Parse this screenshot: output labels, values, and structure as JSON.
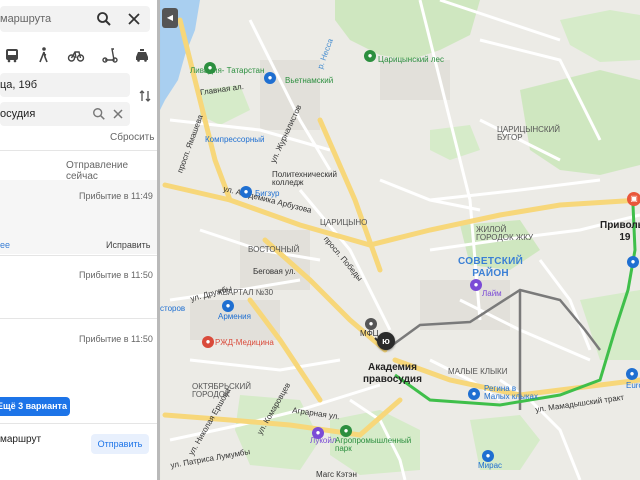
{
  "panel": {
    "search_label": "маршрута",
    "from_value": "ца, 19б",
    "to_value": "осудия",
    "reset_label": "Сбросить",
    "departure_label": "Отправление сейчас",
    "routes": [
      {
        "arrival": "Прибытие в 11:49",
        "more": "ee",
        "fix": "Исправить"
      },
      {
        "arrival": "Прибытие в 11:50"
      },
      {
        "arrival": "Прибытие в 11:50"
      }
    ],
    "more_variants_label": "Ещё 3 варианта",
    "share_label": "маршрут",
    "send_label": "Отправить"
  },
  "map": {
    "labels": {
      "lividia": "Ливадия-\nТатарстан",
      "vietnamsky": "Вьетнамский",
      "tsaritsynsky_les": "Царицынский лес",
      "kompressorny": "Компрессорный",
      "politekh": "Политехнический\nколледж",
      "bigzur": "Бигзур",
      "akademika_arbuzova": "ул. Академика Арбузова",
      "prosp_yamasheva": "просп. Ямашева",
      "zhurnalistov": "ул. Журналистов",
      "sovetsky_rayon": "СОВЕТСКИЙ\nРАЙОН",
      "laim": "Лайм",
      "armenia": "Армения",
      "rzhd": "РЖД-Медицина",
      "mfc": "МФЦ",
      "academy": "Академия\nправосудия",
      "prosp_pobedy": "просп. Победы",
      "agrarnaya": "Аграрная ул.",
      "n_ershova": "ул. Николая Ершова",
      "p_lumumby": "ул. Патриса Лумумбы",
      "lukoil": "Лукойл",
      "agropark": "Агропромышленный\nпарк",
      "magi_kaeen": "Магс Кэтэн",
      "regina": "Регина в\nМалых клыках",
      "mamadyshsky": "ул. Мамадышский тракт",
      "mira": "Мирас",
      "privolzh": "Привольн\n19",
      "oktyabrsky": "ОКТЯБРЬСКИЙ\nГОРОДОК",
      "malye_klyki": "МАЛЫЕ КЛЫКИ",
      "tsaritsyno": "ЦАРИЦЫНО",
      "vostochny": "ВОСТОЧНЫЙ",
      "kvartal": "КВАРТАЛ №30",
      "zhy": "ЖИЛОЙ\nГОРОДОК ЖКУ",
      "beguvaya": "Беговая ул.",
      "druzhby": "ул. Дружбы",
      "komarovtsev": "ул. Комаровцев",
      "vostorov": "сторов",
      "eurospar": "Euro",
      "glavnaya": "Главная ал.",
      "nessa": "р. Несса",
      "tsaritsynsky_bugor": "ЦАРИЦЫНСКИЙ\nБУГОР",
      "kvartirnaya": "КВАРТАЛ"
    }
  }
}
